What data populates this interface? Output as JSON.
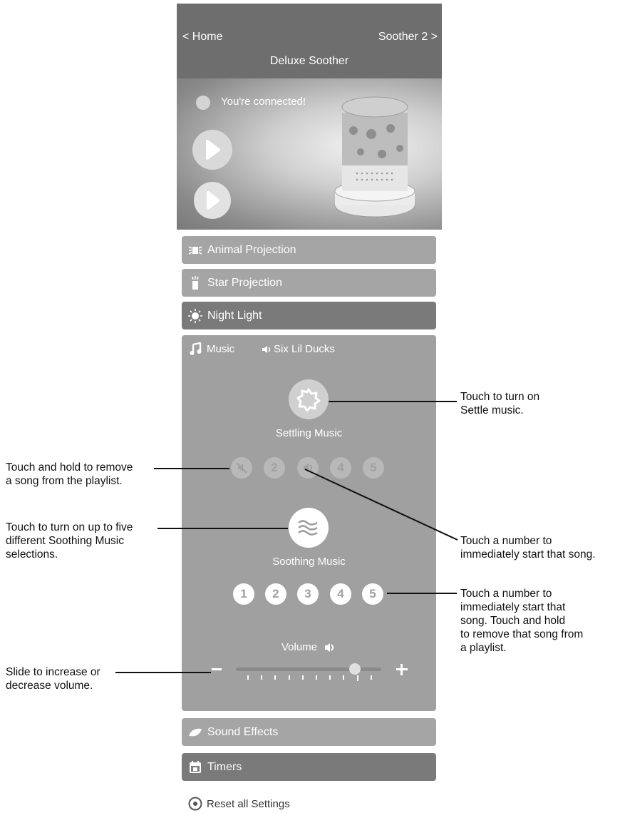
{
  "header": {
    "back_label": "< Home",
    "next_label": "Soother 2 >",
    "title": "Deluxe Soother"
  },
  "hero": {
    "status_text": "You're connected!"
  },
  "sections": {
    "animal_projection": "Animal Projection",
    "star_projection": "Star Projection",
    "night_light": "Night Light",
    "sound_effects": "Sound Effects",
    "timers": "Timers"
  },
  "music": {
    "label": "Music",
    "current_song": "Six Lil Ducks",
    "settling_label": "Settling Music",
    "settling_numbers": [
      "2",
      "4",
      "5"
    ],
    "soothing_label": "Soothing Music",
    "soothing_numbers": [
      "1",
      "2",
      "3",
      "4",
      "5"
    ],
    "volume_label": "Volume",
    "volume_level": 0.82
  },
  "reset_label": "Reset all Settings",
  "callouts": {
    "settle": [
      "Touch to turn on",
      "Settle music."
    ],
    "remove": [
      "Touch and hold to remove",
      "a song from the playlist."
    ],
    "start_song": [
      "Touch a number to",
      "immediately start that song."
    ],
    "soothing": [
      "Touch to turn on up to five",
      "different Soothing Music",
      "selections."
    ],
    "number_hold": [
      "Touch a number to",
      "immediately start that",
      "song. Touch and hold",
      "to remove that song from",
      "a playlist."
    ],
    "volume": [
      "Slide to increase or",
      "decrease volume."
    ]
  },
  "colors": {
    "header": "#6e6e6e",
    "panel_light": "#a5a5a5",
    "panel_dark": "#7a7a7a"
  }
}
